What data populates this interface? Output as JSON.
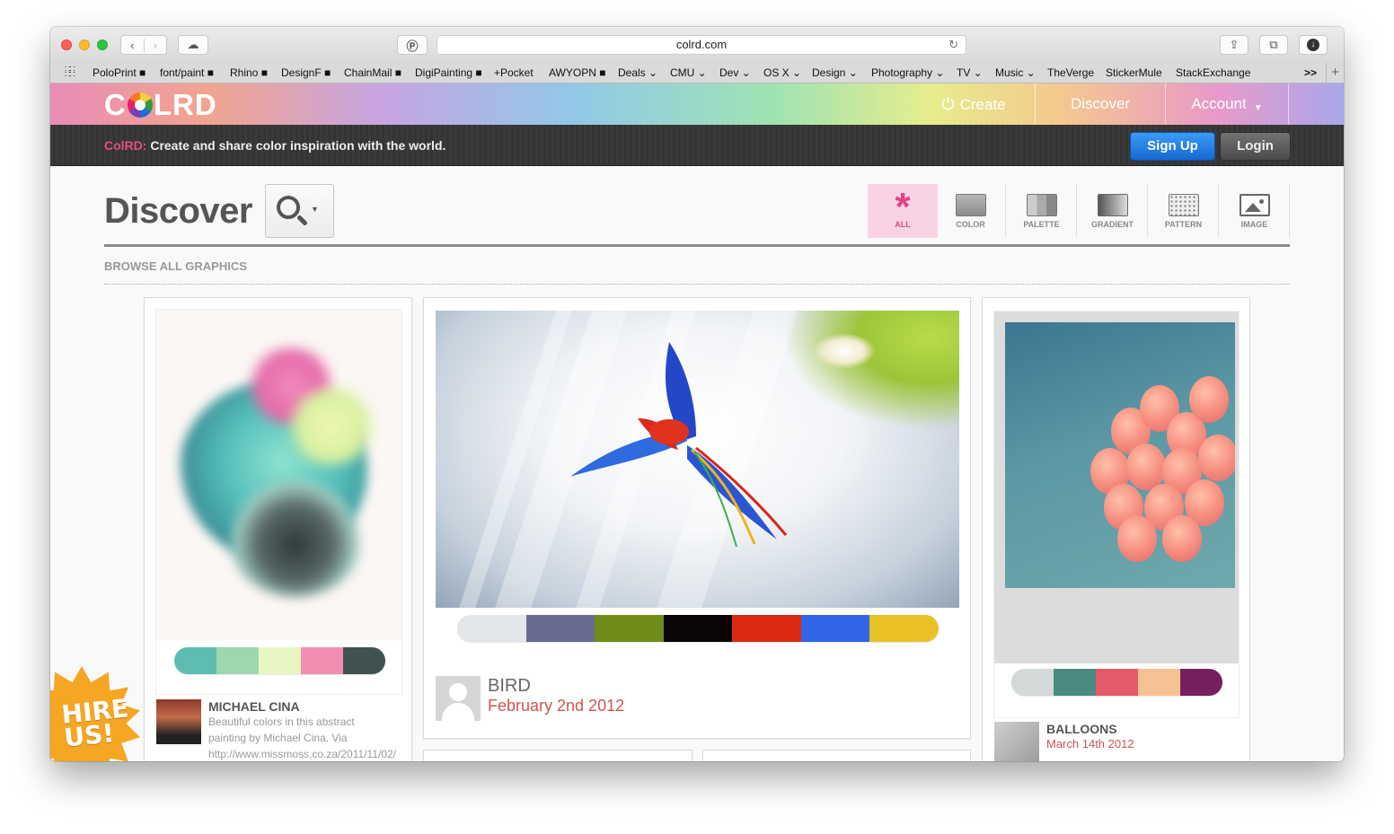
{
  "browser": {
    "address": "colrd.com",
    "bookmarks": [
      "PoloPrint ■",
      "font/paint ■",
      "Rhino ■",
      "DesignF ■",
      "ChainMail ■",
      "DigiPainting ■",
      "+Pocket",
      "AWYOPN ■",
      "Deals ⌄",
      "CMU ⌄",
      "Dev ⌄",
      "OS X ⌄",
      "Design ⌄",
      "Photography ⌄",
      "TV ⌄",
      "Music ⌄",
      "TheVerge",
      "StickerMule",
      "StackExchange"
    ],
    "bookmarks_more": ">>"
  },
  "site": {
    "logo_c": "C",
    "logo_rest": "LRD",
    "nav": {
      "create": "Create",
      "discover": "Discover",
      "account": "Account"
    },
    "banner_brand": "ColRD:",
    "banner_text": " Create and share color inspiration with the world.",
    "signup": "Sign Up",
    "login": "Login"
  },
  "discover": {
    "title": "Discover",
    "filters": [
      "ALL",
      "COLOR",
      "PALETTE",
      "GRADIENT",
      "PATTERN",
      "IMAGE"
    ],
    "browse_label": "BROWSE ALL GRAPHICS"
  },
  "cards": [
    {
      "title": "MICHAEL CINA",
      "desc_1": "Beautiful colors in this abstract",
      "desc_2": "painting by Michael Cina. Via",
      "desc_3": "http://www.missmoss.co.za/2011/11/02/",
      "swatches": [
        "#5fbcb0",
        "#9ed6b0",
        "#e8f6c2",
        "#f38eb3",
        "#3f5151"
      ]
    },
    {
      "title": "BIRD",
      "date": "February 2nd 2012",
      "swatches": [
        "#e4e7ea",
        "#696b93",
        "#6f8d18",
        "#0a0404",
        "#dc2a10",
        "#3266ea",
        "#eac224"
      ]
    },
    {
      "title": "BALLOONS",
      "date": "March 14th 2012",
      "swatches": [
        "#d3d9d8",
        "#4a8b81",
        "#e45a6b",
        "#f7c293",
        "#751f5f"
      ]
    }
  ],
  "promo": {
    "line1": "HIRE",
    "line2": "US!"
  }
}
